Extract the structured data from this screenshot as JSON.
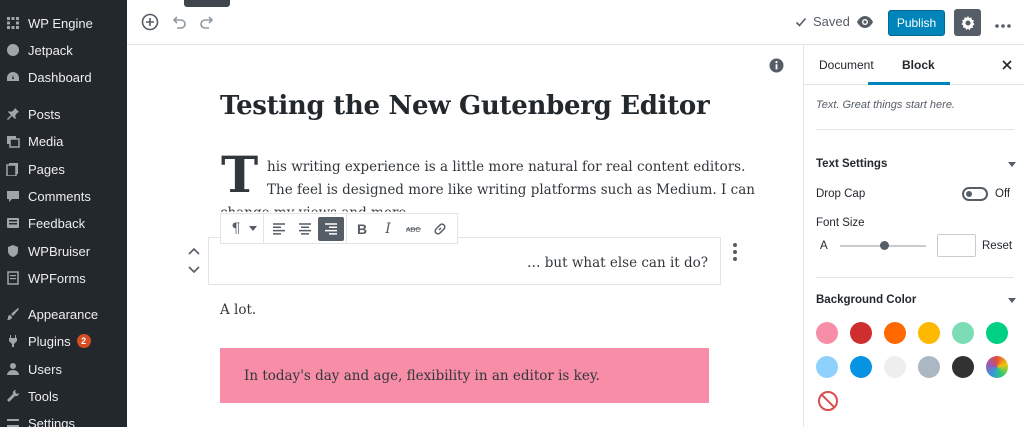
{
  "admin_menu": {
    "items": [
      {
        "label": "WP Engine",
        "icon": "wpengine-icon"
      },
      {
        "label": "Jetpack",
        "icon": "jetpack-icon"
      },
      {
        "label": "Dashboard",
        "icon": "dashboard-icon"
      },
      {
        "label": "Posts",
        "icon": "pin-icon"
      },
      {
        "label": "Media",
        "icon": "media-icon"
      },
      {
        "label": "Pages",
        "icon": "pages-icon"
      },
      {
        "label": "Comments",
        "icon": "comments-icon"
      },
      {
        "label": "Feedback",
        "icon": "feedback-icon"
      },
      {
        "label": "WPBruiser",
        "icon": "shield-icon"
      },
      {
        "label": "WPForms",
        "icon": "forms-icon"
      },
      {
        "label": "Appearance",
        "icon": "brush-icon"
      },
      {
        "label": "Plugins",
        "icon": "plugin-icon",
        "badge": "2"
      },
      {
        "label": "Users",
        "icon": "users-icon"
      },
      {
        "label": "Tools",
        "icon": "wrench-icon"
      },
      {
        "label": "Settings",
        "icon": "settings-icon"
      }
    ]
  },
  "topbar": {
    "saved_label": "Saved",
    "publish_label": "Publish"
  },
  "editor": {
    "title": "Testing the New Gutenberg Editor",
    "dropcap_letter": "T",
    "paragraph_lines": [
      "his writing experience is a little more natural for real content editors.",
      "The feel is designed more like writing platforms such as Medium. I can",
      "change my views and more."
    ],
    "selected_block_text": "… but what else can it do?",
    "short_paragraph": "A lot.",
    "highlight_text": "In today's day and age, flexibility in an editor is key.",
    "highlight_color": "#f78da7"
  },
  "sidebar": {
    "tabs": [
      "Document",
      "Block"
    ],
    "active_tab": "Block",
    "block_description": "Text. Great things start here.",
    "text_settings": {
      "title": "Text Settings",
      "drop_cap_label": "Drop Cap",
      "drop_cap_state": "Off",
      "font_size_label": "Font Size",
      "font_size_letter": "A",
      "reset_label": "Reset"
    },
    "background_color": {
      "title": "Background Color",
      "swatches": [
        "#f78da7",
        "#cf2e2e",
        "#ff6900",
        "#fcb900",
        "#7bdcb5",
        "#00d084",
        "#8ed1fc",
        "#0693e3",
        "#eeeeee",
        "#abb8c3",
        "#313131",
        "custom"
      ]
    }
  }
}
